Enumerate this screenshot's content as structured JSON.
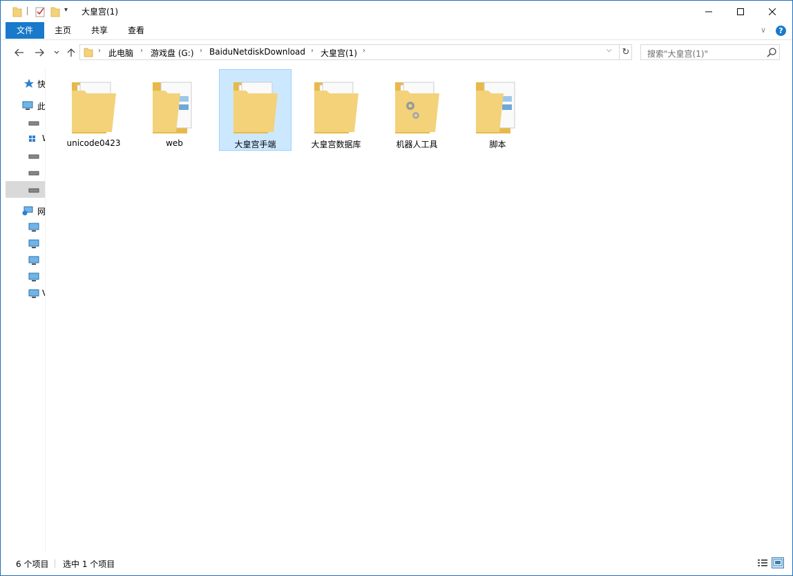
{
  "window": {
    "title": "大皇宫(1)",
    "minimize_glyph": "—",
    "maximize_glyph": "☐",
    "close_glyph": "✕"
  },
  "ribbon": {
    "tabs": [
      "文件",
      "主页",
      "共享",
      "查看"
    ],
    "help_glyph": "?",
    "collapse_glyph": "∨"
  },
  "navigation": {
    "breadcrumbs": [
      "此电脑",
      "游戏盘 (G:)",
      "BaiduNetdiskDownload",
      "大皇宫(1)"
    ],
    "search_placeholder": "搜索\"大皇宫(1)\""
  },
  "nav_pane": {
    "items": [
      {
        "label": "快",
        "icon": "star-icon"
      },
      {
        "label": "此",
        "icon": "computer-icon"
      },
      {
        "label": "​",
        "icon": "drive-icon"
      },
      {
        "label": "W",
        "icon": "windows-drive-icon"
      },
      {
        "label": "​",
        "icon": "drive-icon"
      },
      {
        "label": "​",
        "icon": "drive-icon"
      },
      {
        "label": "​",
        "icon": "drive-icon"
      },
      {
        "label": "网",
        "icon": "network-icon"
      },
      {
        "label": "​",
        "icon": "monitor-icon"
      },
      {
        "label": "​",
        "icon": "monitor-icon"
      },
      {
        "label": "​",
        "icon": "monitor-icon"
      },
      {
        "label": "​",
        "icon": "monitor-icon"
      },
      {
        "label": "V",
        "icon": "monitor-icon"
      }
    ]
  },
  "folders": [
    {
      "name": "unicode0423",
      "icon": "folder-documents-icon"
    },
    {
      "name": "web",
      "icon": "folder-images-icon"
    },
    {
      "name": "大皇宫手端",
      "icon": "folder-documents-icon",
      "selected": true
    },
    {
      "name": "大皇宫数据库",
      "icon": "folder-documents-icon"
    },
    {
      "name": "机器人工具",
      "icon": "folder-gears-icon"
    },
    {
      "name": "脚本",
      "icon": "folder-images-icon"
    }
  ],
  "status": {
    "item_count": "6 个项目",
    "selection": "选中 1 个项目"
  },
  "colors": {
    "accent": "#1979ca",
    "selection_bg": "#cce8ff",
    "selection_border": "#99d1ff",
    "folder": "#f3d27a"
  }
}
